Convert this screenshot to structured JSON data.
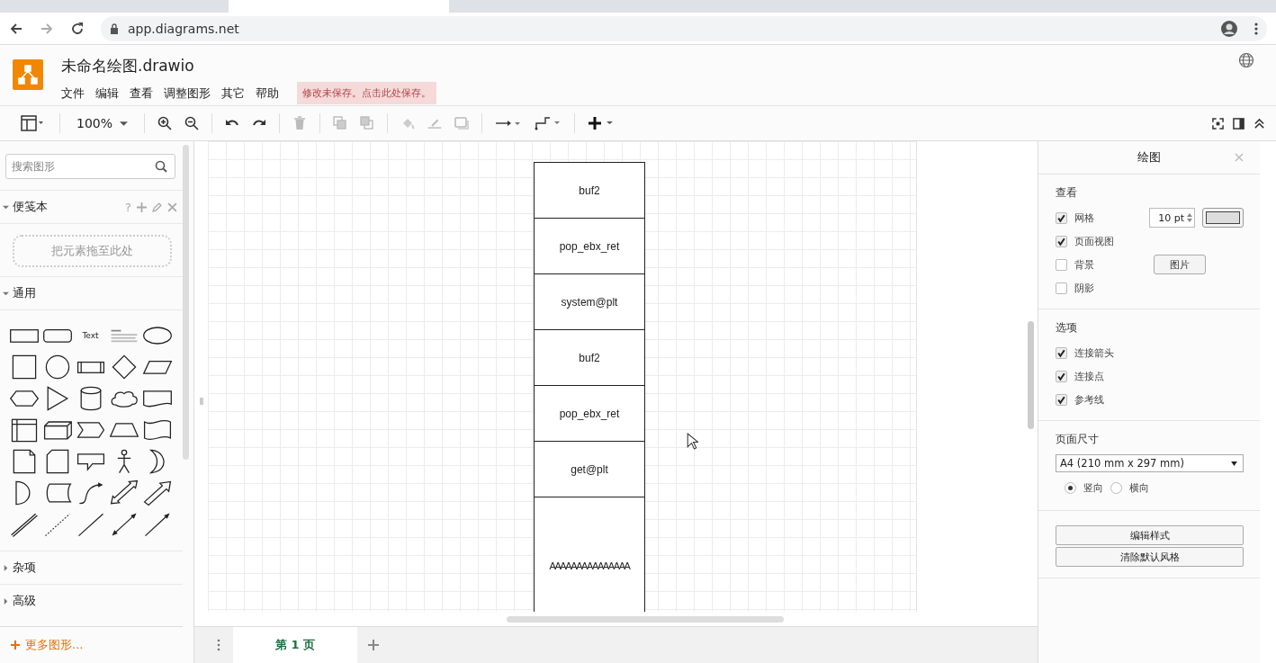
{
  "browser": {
    "address": "app.diagrams.net"
  },
  "app": {
    "title": "未命名绘图.drawio",
    "menus": [
      "文件",
      "编辑",
      "查看",
      "调整图形",
      "其它",
      "帮助"
    ],
    "save_notice": "修改未保存。点击此处保存。"
  },
  "toolbar": {
    "zoom": "100%"
  },
  "sidebar": {
    "search_placeholder": "搜索图形",
    "scratchpad": {
      "title": "便笺本",
      "expanded": true,
      "help": "?",
      "drop_hint": "把元素拖至此处"
    },
    "sections": [
      {
        "title": "通用",
        "expanded": true
      },
      {
        "title": "杂项",
        "expanded": false
      },
      {
        "title": "高级",
        "expanded": false
      }
    ],
    "text_shape": "Text",
    "more_shapes": "更多图形..."
  },
  "canvas": {
    "stack": [
      {
        "label": "buf2",
        "kind": "cell"
      },
      {
        "label": "pop_ebx_ret",
        "kind": "cell"
      },
      {
        "label": "system@plt",
        "kind": "cell"
      },
      {
        "label": "buf2",
        "kind": "cell"
      },
      {
        "label": "pop_ebx_ret",
        "kind": "cell"
      },
      {
        "label": "get@plt",
        "kind": "cell"
      },
      {
        "label": "AAAAAAAAAAAAAAA",
        "kind": "padding"
      }
    ]
  },
  "pages": [
    {
      "label": "第 1 页",
      "selected": true
    }
  ],
  "format_panel": {
    "title": "绘图",
    "view": {
      "title": "查看",
      "options": [
        {
          "label": "网格",
          "checked": true
        },
        {
          "label": "页面视图",
          "checked": true
        },
        {
          "label": "背景",
          "checked": false
        },
        {
          "label": "阴影",
          "checked": false
        }
      ],
      "grid_size": "10 pt",
      "image_button": "图片"
    },
    "options": {
      "title": "选项",
      "items": [
        {
          "label": "连接箭头",
          "checked": true
        },
        {
          "label": "连接点",
          "checked": true
        },
        {
          "label": "参考线",
          "checked": true
        }
      ]
    },
    "page_size": {
      "title": "页面尺寸",
      "value": "A4 (210 mm x 297 mm)",
      "orientations": [
        {
          "label": "竖向",
          "selected": true
        },
        {
          "label": "横向",
          "selected": false
        }
      ]
    },
    "buttons": [
      "编辑样式",
      "清除默认风格"
    ]
  }
}
